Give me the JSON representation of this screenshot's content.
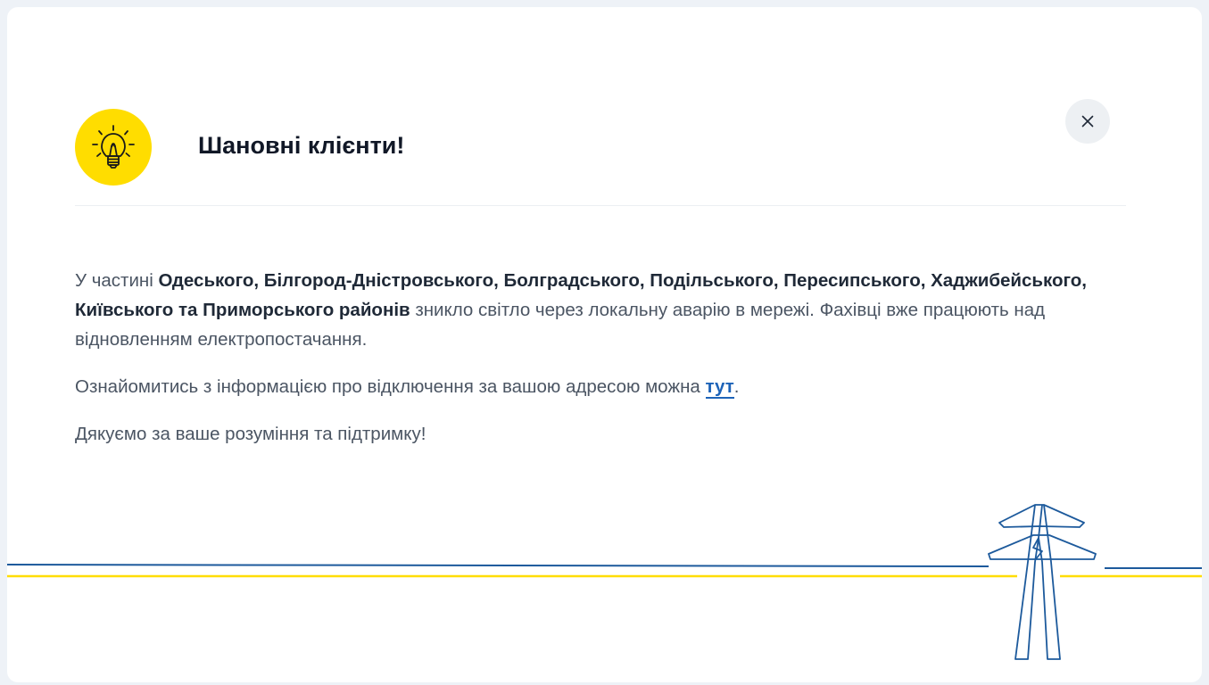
{
  "modal": {
    "title": "Шановні клієнти!",
    "icon": "lightbulb-icon",
    "close_icon": "close-icon",
    "accent_color": "#ffdd00",
    "link_color": "#1d63b8"
  },
  "message": {
    "p1_prefix": "У частині ",
    "p1_districts": "Одеського, Білгород-Дністровського, Болградського, Подільського, Пересипського, Хаджибейського, Київського та Приморського районів",
    "p1_suffix": " зникло світло через локальну аварію в мережі. Фахівці вже працюють над відновленням електропостачання.",
    "p2_prefix": "Ознайомитись з інформацією про відключення за вашою адресою можна ",
    "p2_link": "тут",
    "p2_suffix": ".",
    "p3": "Дякуємо за ваше розуміння та підтримку!"
  },
  "decoration": {
    "icon": "power-tower-icon",
    "line_blue": "#1d5a9c",
    "line_yellow": "#ffdd00"
  }
}
